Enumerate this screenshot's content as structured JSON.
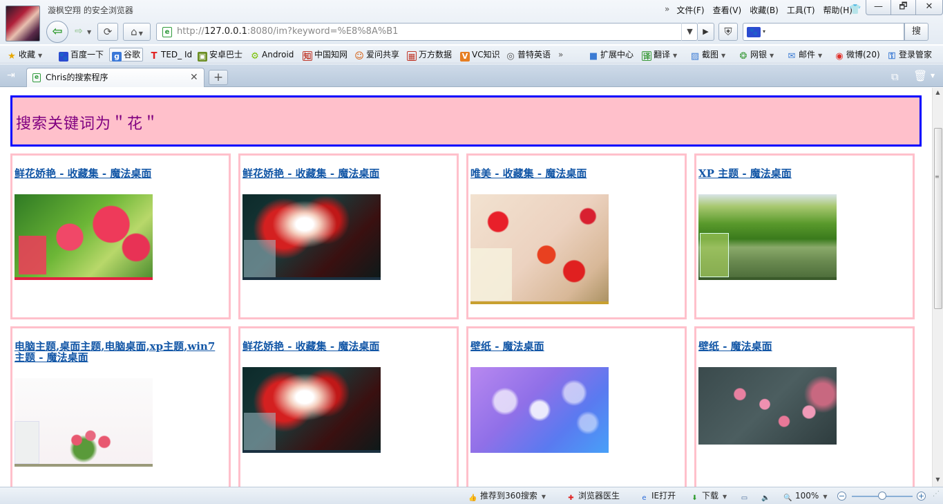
{
  "window": {
    "title": "漩枫空翔 的安全浏览器",
    "menu": [
      "文件(F)",
      "查看(V)",
      "收藏(B)",
      "工具(T)",
      "帮助(H)"
    ],
    "menu_chevron": "»",
    "controls": {
      "minimize": "—",
      "maximize": "🗗",
      "close": "✕"
    }
  },
  "navigation": {
    "url_scheme": "http://",
    "url_host": "127.0.0.1",
    "url_rest": ":8080/im?keyword=%E8%8A%B1",
    "search_placeholder": "",
    "search_button": "搜"
  },
  "bookmarks": [
    {
      "label": "收藏",
      "icon": "star-icon",
      "color": "#e8a800",
      "dropdown": true
    },
    {
      "label": "百度一下",
      "icon": "baidu-paw-icon",
      "color": "#2b4bd0"
    },
    {
      "label": "谷歌",
      "icon": "google-g-icon",
      "color": "#3a78d8"
    },
    {
      "label": "TED_ Id",
      "icon": "ted-t-icon",
      "color": "#e02020"
    },
    {
      "label": "安卓巴士",
      "icon": "android-bus-icon",
      "color": "#6b8e23"
    },
    {
      "label": "Android",
      "icon": "android-robot-icon",
      "color": "#78c000"
    },
    {
      "label": "中国知网",
      "icon": "cnki-icon",
      "color": "#c0392b"
    },
    {
      "label": "爱问共享",
      "icon": "iask-person-icon",
      "color": "#d35400"
    },
    {
      "label": "万方数据",
      "icon": "wanfang-icon",
      "color": "#c0392b"
    },
    {
      "label": "VC知识",
      "icon": "vc-icon",
      "color": "#e67e22"
    },
    {
      "label": "普特英语",
      "icon": "putclub-icon",
      "color": "#555555"
    }
  ],
  "bookmarks_more": "»",
  "bookmark_tools": [
    {
      "label": "扩展中心",
      "icon": "extension-cube-icon",
      "color": "#3b7bd4"
    },
    {
      "label": "翻译",
      "icon": "translate-icon",
      "color": "#3a9a3a",
      "dropdown": true
    },
    {
      "label": "截图",
      "icon": "screenshot-icon",
      "color": "#3b7bd4",
      "dropdown": true
    },
    {
      "label": "网银",
      "icon": "ebank-icon",
      "color": "#3a9a3a",
      "dropdown": true
    },
    {
      "label": "邮件",
      "icon": "mail-icon",
      "color": "#3b7bd4",
      "dropdown": true
    },
    {
      "label": "微博(20)",
      "icon": "weibo-icon",
      "color": "#e0302a"
    },
    {
      "label": "登录管家",
      "icon": "key-icon",
      "color": "#3b7bd4"
    }
  ],
  "tabs": [
    {
      "title": "Chris的搜索程序",
      "close": "✕",
      "active": true
    }
  ],
  "new_tab": "+",
  "page": {
    "heading": "搜索关键词为＂花＂",
    "results": [
      {
        "title": "鲜花娇艳 - 收藏集 - 魔法桌面",
        "image": "red-hibiscus-flowers-thumbnail"
      },
      {
        "title": "鲜花娇艳 - 收藏集 - 魔法桌面",
        "image": "red-spider-lily-thumbnail"
      },
      {
        "title": "唯美 - 收藏集 - 魔法桌面",
        "image": "red-cosmos-flowers-thumbnail"
      },
      {
        "title": "XP 主题 - 魔法桌面",
        "image": "green-landscape-lake-thumbnail"
      },
      {
        "title": "电脑主题,桌面主题,电脑桌面,xp主题,win7主题 - 魔法桌面",
        "image": "cartoon-pink-roses-thumbnail"
      },
      {
        "title": "鲜花娇艳 - 收藏集 - 魔法桌面",
        "image": "red-spider-lily-thumbnail"
      },
      {
        "title": "壁纸 - 魔法桌面",
        "image": "purple-glass-flowers-thumbnail"
      },
      {
        "title": "壁纸 - 魔法桌面",
        "image": "pink-blossom-branch-thumbnail"
      }
    ]
  },
  "status_bar": {
    "recommend": "推荐到360搜索",
    "doctor": "浏览器医生",
    "ie_open": "IE打开",
    "download": "下载",
    "zoom": "100%",
    "zoom_minus": "−",
    "zoom_plus": "+",
    "zoom_level": 0.5
  },
  "colors": {
    "heading_border": "#0000ff",
    "heading_background": "#ffc0cb",
    "heading_text": "#800080",
    "card_border": "#ffc0cb",
    "link": "#1256a6"
  }
}
